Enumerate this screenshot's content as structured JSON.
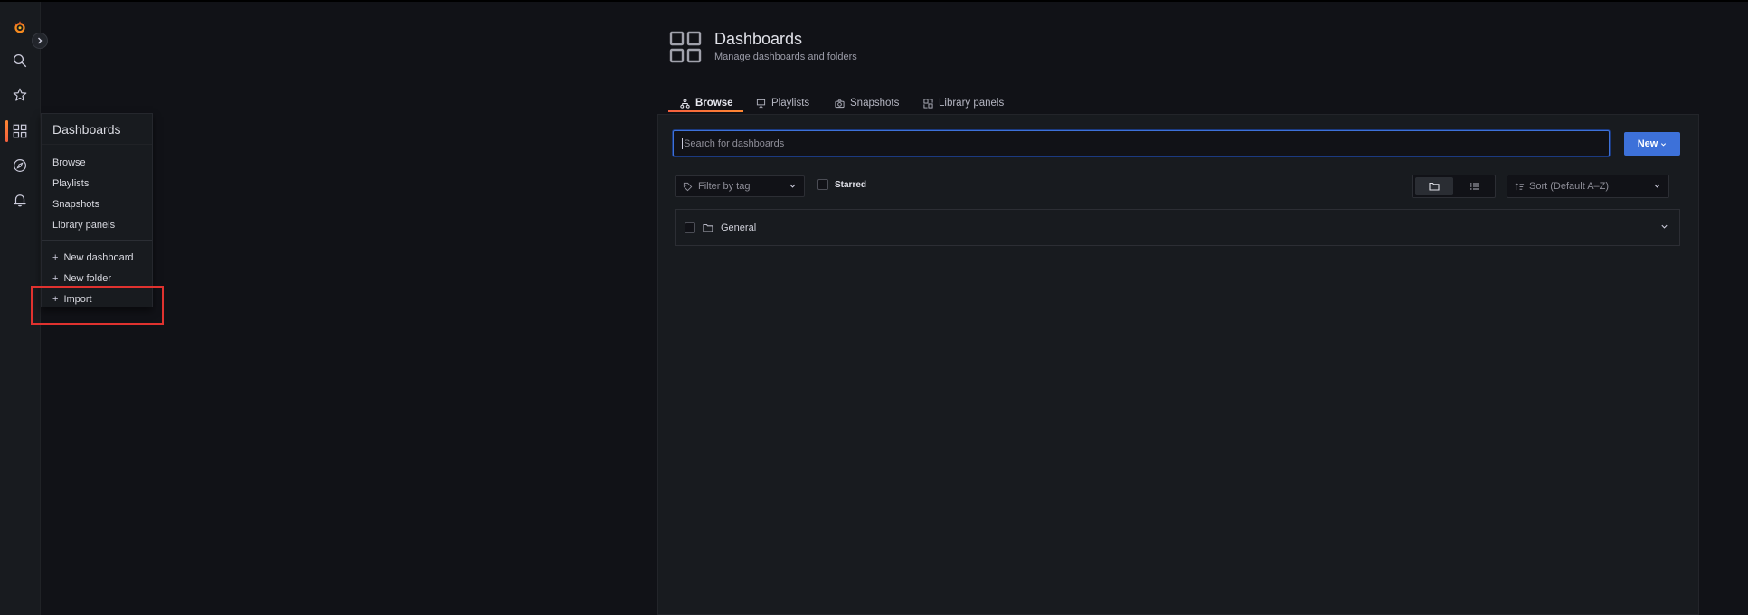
{
  "app": {
    "accent": "#ff8833",
    "primary": "#3d71d9",
    "danger_outline": "#e0322f"
  },
  "rail": {
    "icons": [
      "grafana-logo-icon",
      "search-icon",
      "star-icon",
      "dashboards-icon",
      "explore-compass-icon",
      "alerting-bell-icon"
    ],
    "active": "dashboards-icon"
  },
  "flyout": {
    "title": "Dashboards",
    "items": [
      {
        "label": "Browse"
      },
      {
        "label": "Playlists"
      },
      {
        "label": "Snapshots"
      },
      {
        "label": "Library panels"
      }
    ],
    "actions": [
      {
        "label": "New dashboard"
      },
      {
        "label": "New folder"
      },
      {
        "label": "Import"
      }
    ]
  },
  "page": {
    "title": "Dashboards",
    "subtitle": "Manage dashboards and folders"
  },
  "tabs": [
    {
      "label": "Browse",
      "icon": "sitemap-icon",
      "active": true
    },
    {
      "label": "Playlists",
      "icon": "presentation-icon",
      "active": false
    },
    {
      "label": "Snapshots",
      "icon": "camera-icon",
      "active": false
    },
    {
      "label": "Library panels",
      "icon": "library-panels-icon",
      "active": false
    }
  ],
  "search": {
    "placeholder": "Search for dashboards"
  },
  "new_button": {
    "label": "New"
  },
  "filters": {
    "tag_placeholder": "Filter by tag",
    "starred_label": "Starred",
    "sort_label": "Sort (Default A–Z)",
    "view_mode": "folders"
  },
  "folders": [
    {
      "name": "General"
    }
  ]
}
